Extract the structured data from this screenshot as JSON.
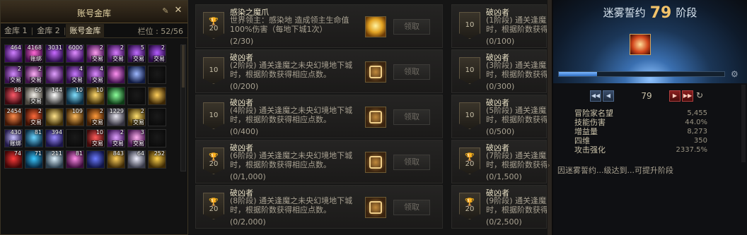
{
  "warehouse": {
    "title": "账号金库",
    "close_label": "✕",
    "pin_label": "✎",
    "tabs": [
      {
        "label": "金库 1",
        "active": false
      },
      {
        "label": "金库 2",
        "active": false
      },
      {
        "label": "账号金库",
        "active": true
      }
    ],
    "slots_label": "栏位 : 52/56",
    "items": [
      {
        "count": "464",
        "tag": "",
        "c1": "#d080ff",
        "c2": "#3a0f5c"
      },
      {
        "count": "4168",
        "tag": "账绑",
        "c1": "#ff6ad4",
        "c2": "#3c0a44"
      },
      {
        "count": "3031",
        "tag": "",
        "c1": "#c86aff",
        "c2": "#2a0e4a"
      },
      {
        "count": "6000",
        "tag": "",
        "c1": "#e08cff",
        "c2": "#3a1060"
      },
      {
        "count": "2",
        "tag": "交易",
        "c1": "#ff9df0",
        "c2": "#401050"
      },
      {
        "count": "2",
        "tag": "交易",
        "c1": "#d97bff",
        "c2": "#35104e"
      },
      {
        "count": "5",
        "tag": "交易",
        "c1": "#c06cff",
        "c2": "#2c0c48"
      },
      {
        "count": "2",
        "tag": "交易",
        "c1": "#b45cff",
        "c2": "#280a42"
      },
      {
        "count": "2",
        "tag": "交易",
        "c1": "#d48cff",
        "c2": "#36104c"
      },
      {
        "count": "2",
        "tag": "交易",
        "c1": "#ffb0f8",
        "c2": "#40124a"
      },
      {
        "count": "",
        "tag": "",
        "c1": "#e2a0ff",
        "c2": "#3a1252"
      },
      {
        "count": "4",
        "tag": "交易",
        "c1": "#c878ff",
        "c2": "#2e0e48"
      },
      {
        "count": "4",
        "tag": "交易",
        "c1": "#dc8aff",
        "c2": "#381250"
      },
      {
        "count": "",
        "tag": "",
        "c1": "#ff90f0",
        "c2": "#3e104c"
      },
      {
        "count": "",
        "tag": "",
        "c1": "#9db8ff",
        "c2": "#101a40"
      },
      {
        "count": "",
        "tag": "",
        "c1": "#1a1a1a",
        "c2": "#0c0c0c"
      },
      {
        "count": "98",
        "tag": "",
        "c1": "#ff5a6a",
        "c2": "#3c0a10"
      },
      {
        "count": "60",
        "tag": "交易",
        "c1": "#f3f0ea",
        "c2": "#4a463e"
      },
      {
        "count": "144",
        "tag": "",
        "c1": "#ffffff",
        "c2": "#3a3a3a"
      },
      {
        "count": "10",
        "tag": "",
        "c1": "#80e0ff",
        "c2": "#0c2c40"
      },
      {
        "count": "10",
        "tag": "",
        "c1": "#ffd86a",
        "c2": "#3a2a08"
      },
      {
        "count": "",
        "tag": "",
        "c1": "#8aff9a",
        "c2": "#0e3a16"
      },
      {
        "count": "",
        "tag": "",
        "c1": "#1a1a1a",
        "c2": "#0c0c0c"
      },
      {
        "count": "",
        "tag": "",
        "c1": "#ffcf5a",
        "c2": "#3a2606"
      },
      {
        "count": "2454",
        "tag": "",
        "c1": "#ff8a4a",
        "c2": "#3e1606"
      },
      {
        "count": "2",
        "tag": "交易",
        "c1": "#ff6a3a",
        "c2": "#3c1004"
      },
      {
        "count": "",
        "tag": "",
        "c1": "#ffe38a",
        "c2": "#3e2e08"
      },
      {
        "count": "109",
        "tag": "",
        "c1": "#ffba5a",
        "c2": "#3e2406"
      },
      {
        "count": "2",
        "tag": "交易",
        "c1": "#ff9a3a",
        "c2": "#3e1c04"
      },
      {
        "count": "1229",
        "tag": "",
        "c1": "#e8e6f0",
        "c2": "#34323e"
      },
      {
        "count": "2",
        "tag": "交易",
        "c1": "#ffe070",
        "c2": "#402e06"
      },
      {
        "count": "",
        "tag": "",
        "c1": "#1a1a1a",
        "c2": "#0c0c0c"
      },
      {
        "count": "430",
        "tag": "账绑",
        "c1": "#c8c0ff",
        "c2": "#221a48"
      },
      {
        "count": "81",
        "tag": "",
        "c1": "#6ad4ff",
        "c2": "#0a2a40"
      },
      {
        "count": "394",
        "tag": "",
        "c1": "#9a8aff",
        "c2": "#1a1448"
      },
      {
        "count": "",
        "tag": "",
        "c1": "#1a1a1a",
        "c2": "#0c0c0c"
      },
      {
        "count": "10",
        "tag": "交易",
        "c1": "#ff5a5a",
        "c2": "#3e0a0a"
      },
      {
        "count": "2",
        "tag": "交易",
        "c1": "#e0a0ff",
        "c2": "#36104e"
      },
      {
        "count": "3",
        "tag": "交易",
        "c1": "#ffb0f0",
        "c2": "#40124a"
      },
      {
        "count": "",
        "tag": "",
        "c1": "#1a1a1a",
        "c2": "#0c0c0c"
      },
      {
        "count": "74",
        "tag": "",
        "c1": "#ff3a3a",
        "c2": "#3e0606"
      },
      {
        "count": "71",
        "tag": "",
        "c1": "#3ac8ff",
        "c2": "#06263e"
      },
      {
        "count": "211",
        "tag": "",
        "c1": "#e0f4ff",
        "c2": "#2a3c4a"
      },
      {
        "count": "81",
        "tag": "",
        "c1": "#ff8ae8",
        "c2": "#3c0c3a"
      },
      {
        "count": "",
        "tag": "",
        "c1": "#6a7aff",
        "c2": "#101444"
      },
      {
        "count": "843",
        "tag": "",
        "c1": "#ffd05a",
        "c2": "#3e2a06"
      },
      {
        "count": "64",
        "tag": "",
        "c1": "#f0f0ff",
        "c2": "#383a48"
      },
      {
        "count": "252",
        "tag": "",
        "c1": "#ffd24a",
        "c2": "#3e2a04"
      }
    ]
  },
  "achievements": {
    "claim_label": "领取",
    "left": [
      {
        "points": "20",
        "trophy": true,
        "name": "感染之魔爪",
        "desc": "世界领主：感染地       造成领主生命值100%伤害（每地下城1次）",
        "progress": "(2/30)",
        "reward": "gold"
      },
      {
        "points": "10",
        "trophy": false,
        "name": "破凶者",
        "desc": "(2阶段) 通关逢魔之未央幻境地下城时，根据阶数获得相应点数。",
        "progress": "(0/200)",
        "reward": "emblem"
      },
      {
        "points": "10",
        "trophy": false,
        "name": "破凶者",
        "desc": "(4阶段) 通关逢魔之未央幻境地下城时，根据阶数获得相应点数。",
        "progress": "(0/400)",
        "reward": "emblem"
      },
      {
        "points": "20",
        "trophy": true,
        "name": "破凶者",
        "desc": "(6阶段) 通关逢魔之未央幻境地下城时，根据阶数获得相应点数。",
        "progress": "(0/1,000)",
        "reward": "emblem"
      },
      {
        "points": "20",
        "trophy": true,
        "name": "破凶者",
        "desc": "(8阶段) 通关逢魔之未央幻境地下城时，根据阶数获得相应点数。",
        "progress": "(0/2,000)",
        "reward": "emblem"
      }
    ],
    "right": [
      {
        "points": "10",
        "trophy": false,
        "name": "破凶者",
        "desc": "(1阶段) 通关逢魔之未央幻境地下城时，根据阶数获得相应点数。",
        "progress": "(0/100)"
      },
      {
        "points": "10",
        "trophy": false,
        "name": "破凶者",
        "desc": "(3阶段) 通关逢魔之未央幻境地下城时，根据阶数获得相应点数。",
        "progress": "(0/300)"
      },
      {
        "points": "10",
        "trophy": false,
        "name": "破凶者",
        "desc": "(5阶段) 通关逢魔之未央幻境地下城时，根据阶数获得相应点数。",
        "progress": "(0/500)"
      },
      {
        "points": "20",
        "trophy": true,
        "name": "破凶者",
        "desc": "(7阶段) 通关逢魔之未央幻境地下城时，根据阶数获得相应点数。",
        "progress": "(0/1,500)"
      },
      {
        "points": "20",
        "trophy": true,
        "name": "破凶者",
        "desc": "(9阶段) 通关逢魔之未央幻境地下城时，根据阶数获得相应点数。",
        "progress": "(0/2,500)"
      }
    ]
  },
  "pact": {
    "title_prefix": "迷雾誓约",
    "level": "79",
    "title_suffix": "阶段",
    "progress_fraction": 0.23,
    "current_stage": "79",
    "stats": [
      {
        "label": "冒险家名望",
        "value": "5,455"
      },
      {
        "label": "技能伤害",
        "value": "44.0%"
      },
      {
        "label": "增益量",
        "value": "8,273"
      },
      {
        "label": "四维",
        "value": "350"
      },
      {
        "label": "攻击强化",
        "value": "2337.5%"
      }
    ],
    "note": "因迷雾誓约...级达到...可提升阶段"
  },
  "colors": {
    "accent_gold": "#f2c36a",
    "pact_blue": "#3a6fb0"
  }
}
